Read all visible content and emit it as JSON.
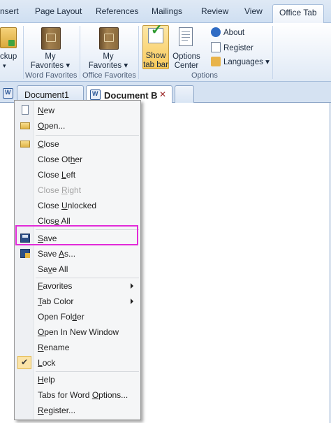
{
  "ribbon_tabs": [
    "nsert",
    "Page Layout",
    "References",
    "Mailings",
    "Review",
    "View",
    "Office Tab"
  ],
  "ribbon": {
    "backup_label_1": "ckup",
    "backup_label_2": "▾",
    "my_favorites_1": {
      "line1": "My",
      "line2": "Favorites ▾"
    },
    "my_favorites_2": {
      "line1": "My",
      "line2": "Favorites ▾"
    },
    "group_word_favorites": "Word Favorites",
    "group_office_favorites": "Office Favorites",
    "show_tab_bar": {
      "line1": "Show",
      "line2": "tab bar"
    },
    "options_center": {
      "line1": "Options",
      "line2": "Center"
    },
    "about": "About",
    "register": "Register",
    "languages": "Languages ▾",
    "group_options": "Options"
  },
  "document_tabs": {
    "tab1": "Document1",
    "tab2": "Document B",
    "close_glyph": "✕"
  },
  "context_menu": {
    "new": {
      "pre": "",
      "u": "N",
      "post": "ew"
    },
    "open": {
      "pre": "",
      "u": "O",
      "post": "pen..."
    },
    "close": {
      "pre": "",
      "u": "C",
      "post": "lose"
    },
    "close_other": {
      "pre": "Close Ot",
      "u": "h",
      "post": "er"
    },
    "close_left": {
      "pre": "Close ",
      "u": "L",
      "post": "eft"
    },
    "close_right": {
      "pre": "Close ",
      "u": "R",
      "post": "ight"
    },
    "close_unlocked": {
      "pre": "Close ",
      "u": "U",
      "post": "nlocked"
    },
    "close_all": {
      "pre": "Clos",
      "u": "e",
      "post": " All"
    },
    "save": {
      "pre": "",
      "u": "S",
      "post": "ave"
    },
    "save_as": {
      "pre": "Save ",
      "u": "A",
      "post": "s..."
    },
    "save_all": {
      "pre": "Sa",
      "u": "v",
      "post": "e All"
    },
    "favorites": {
      "pre": "",
      "u": "F",
      "post": "avorites"
    },
    "tab_color": {
      "pre": "",
      "u": "T",
      "post": "ab Color"
    },
    "open_folder": {
      "pre": "Open Fol",
      "u": "d",
      "post": "er"
    },
    "open_new_window": {
      "pre": "",
      "u": "O",
      "post": "pen In New Window"
    },
    "rename": {
      "pre": "",
      "u": "R",
      "post": "ename"
    },
    "lock": {
      "pre": "",
      "u": "L",
      "post": "ock"
    },
    "help": {
      "pre": "",
      "u": "H",
      "post": "elp"
    },
    "tabs_options": {
      "pre": "Tabs for Word ",
      "u": "O",
      "post": "ptions..."
    },
    "register": {
      "pre": "",
      "u": "R",
      "post": "egister..."
    },
    "checkmark_glyph": "✔"
  },
  "colors": {
    "highlight": "#e22ad8",
    "ribbon_bg": "#dfe9f5",
    "menu_bg": "#f5f6f7"
  }
}
